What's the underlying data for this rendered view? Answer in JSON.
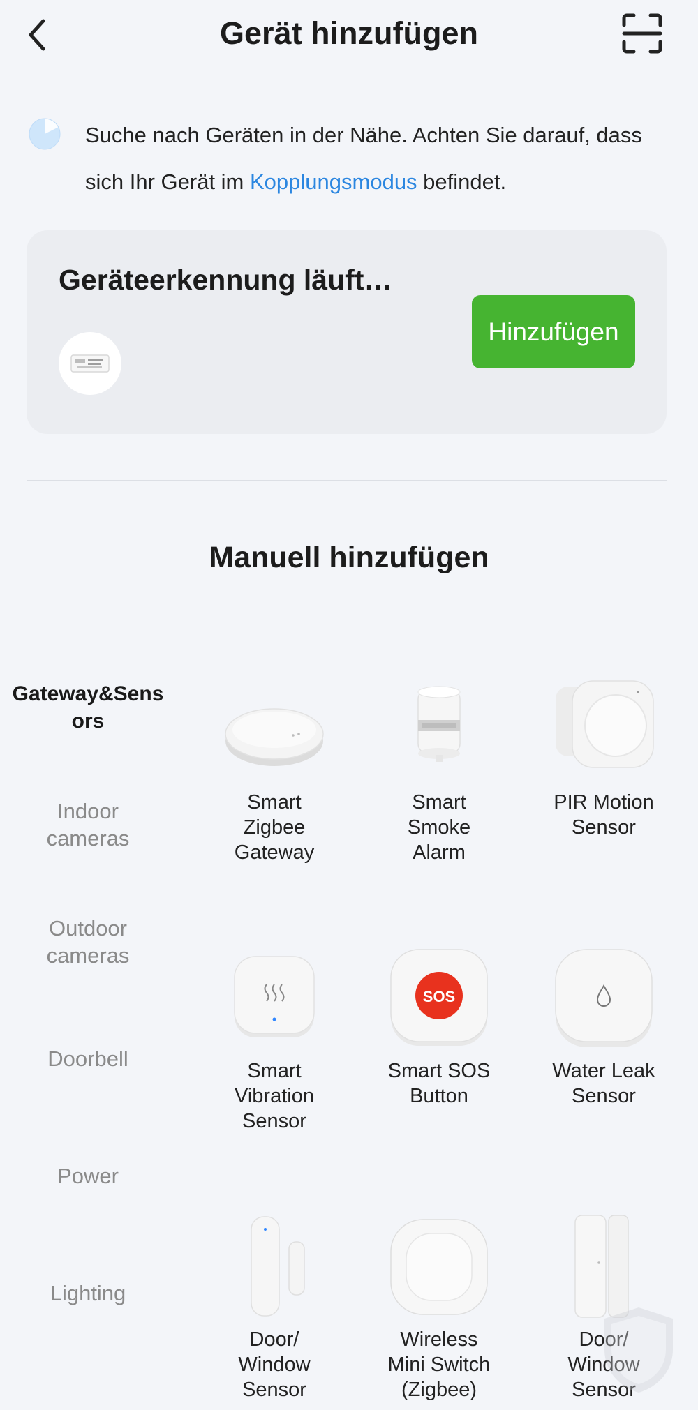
{
  "header": {
    "title": "Gerät hinzufügen",
    "back_icon": "chevron-left-icon",
    "scan_icon": "scan-frame-icon"
  },
  "search": {
    "text_before_link": "Suche nach Geräten in der Nähe. Achten Sie darauf, dass sich Ihr Gerät im ",
    "link_text": "Kopplungsmodus",
    "text_after_link": " befindet.",
    "link_color": "#2b86e0",
    "spinner_icon": "loading-spinner-icon"
  },
  "detection": {
    "title": "Geräteerkennung läuft…",
    "add_button": "Hinzufügen",
    "button_color": "#46b431",
    "device_icon": "zigbee-module-icon"
  },
  "manual": {
    "title": "Manuell hinzufügen"
  },
  "categories": [
    {
      "label": "Gateway&Sens\nors",
      "active": true
    },
    {
      "label": "Indoor\ncameras",
      "active": false
    },
    {
      "label": "Outdoor\ncameras",
      "active": false
    },
    {
      "label": "Doorbell",
      "active": false
    },
    {
      "label": "Power",
      "active": false
    },
    {
      "label": "Lighting",
      "active": false
    }
  ],
  "products": [
    {
      "label": "Smart\nZigbee\nGateway",
      "icon": "gateway-hub-icon"
    },
    {
      "label": "Smart\nSmoke\nAlarm",
      "icon": "smoke-alarm-icon"
    },
    {
      "label": "PIR Motion\nSensor",
      "icon": "motion-sensor-icon"
    },
    {
      "label": "Smart\nVibration\nSensor",
      "icon": "vibration-sensor-icon"
    },
    {
      "label": "Smart SOS\nButton",
      "icon": "sos-button-icon",
      "badge": "SOS"
    },
    {
      "label": "Water Leak\nSensor",
      "icon": "water-leak-sensor-icon"
    },
    {
      "label": "Door/\nWindow\nSensor",
      "icon": "door-window-sensor-icon"
    },
    {
      "label": "Wireless\nMini Switch\n(Zigbee)",
      "icon": "mini-switch-icon"
    },
    {
      "label": "Door/\nWindow\nSensor",
      "icon": "door-window-sensor-slim-icon"
    }
  ]
}
